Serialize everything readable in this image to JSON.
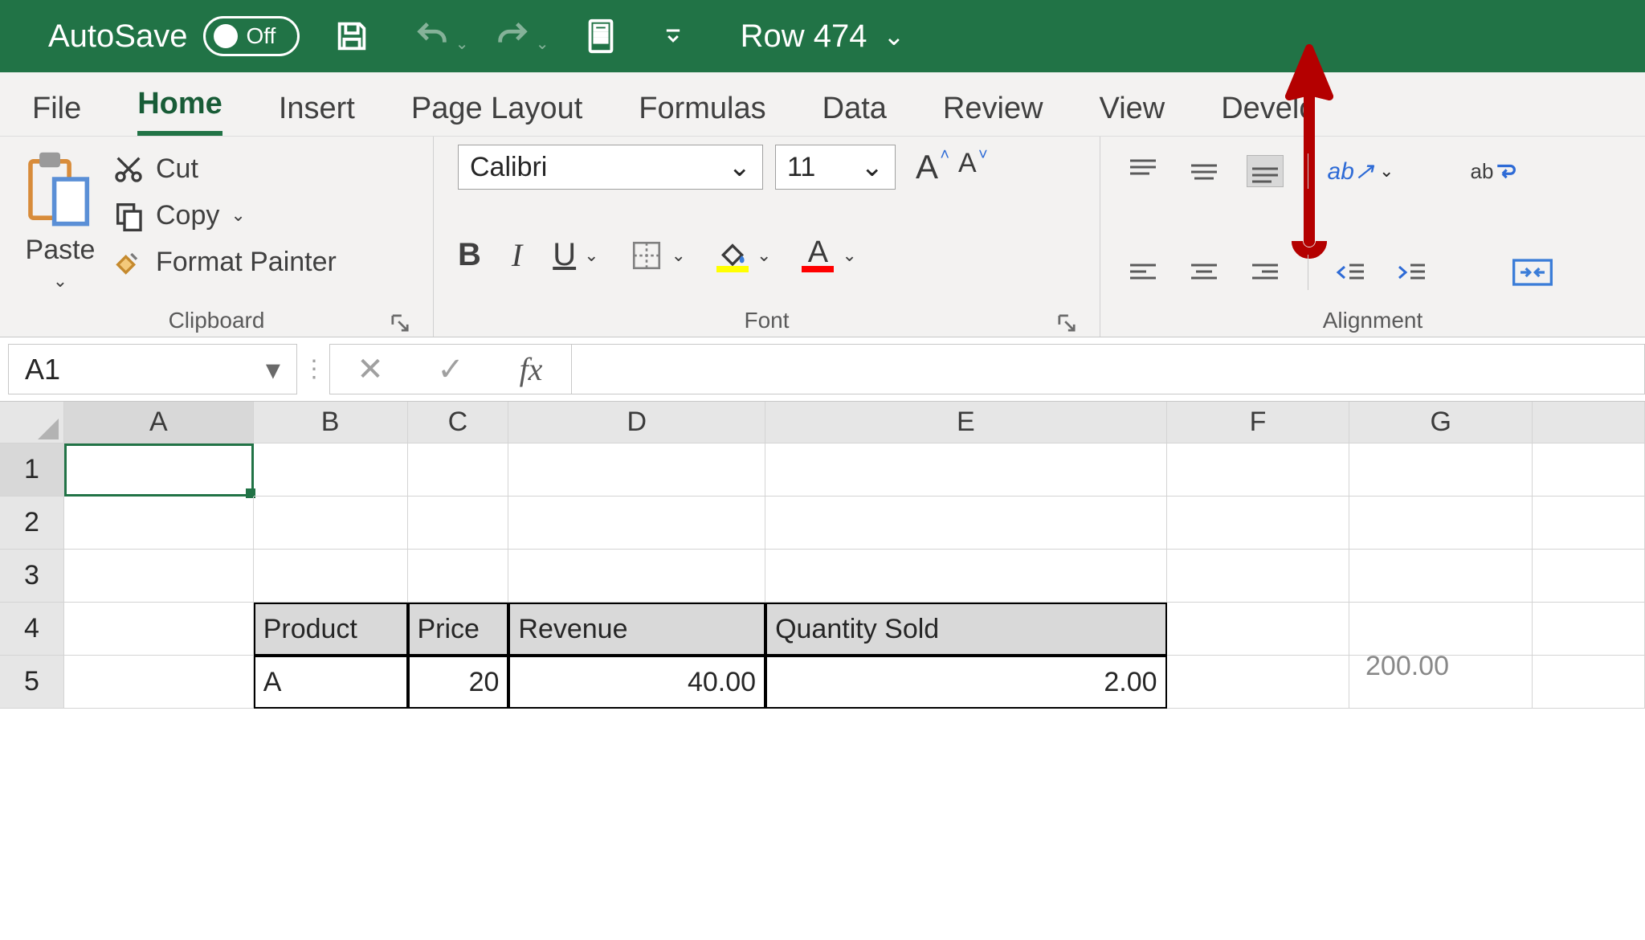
{
  "titlebar": {
    "autosave_label": "AutoSave",
    "autosave_state": "Off",
    "document_title": "Row 474"
  },
  "tabs": {
    "file": "File",
    "home": "Home",
    "insert": "Insert",
    "page_layout": "Page Layout",
    "formulas": "Formulas",
    "data": "Data",
    "review": "Review",
    "view": "View",
    "developer": "Develo"
  },
  "ribbon": {
    "clipboard": {
      "paste": "Paste",
      "cut": "Cut",
      "copy": "Copy",
      "format_painter": "Format Painter",
      "group_label": "Clipboard"
    },
    "font": {
      "font_name": "Calibri",
      "font_size": "11",
      "bold": "B",
      "italic": "I",
      "underline": "U",
      "group_label": "Font"
    },
    "alignment": {
      "group_label": "Alignment",
      "wrap_char": "ab"
    }
  },
  "formula_bar": {
    "name_box": "A1",
    "fx": "fx",
    "formula": ""
  },
  "grid": {
    "columns": [
      "A",
      "B",
      "C",
      "D",
      "E",
      "F",
      "G"
    ],
    "rows": [
      "1",
      "2",
      "3",
      "4",
      "5"
    ],
    "selected_cell": "A1",
    "table_headers": {
      "product": "Product",
      "price": "Price",
      "revenue": "Revenue",
      "quantity": "Quantity Sold"
    },
    "table_row1": {
      "product": "A",
      "price": "20",
      "revenue": "40.00",
      "quantity": "2.00"
    },
    "floating_value": "200.00"
  },
  "chart_data": {
    "type": "table",
    "columns": [
      "Product",
      "Price",
      "Revenue",
      "Quantity Sold"
    ],
    "rows": [
      [
        "A",
        20,
        40.0,
        2.0
      ]
    ]
  }
}
